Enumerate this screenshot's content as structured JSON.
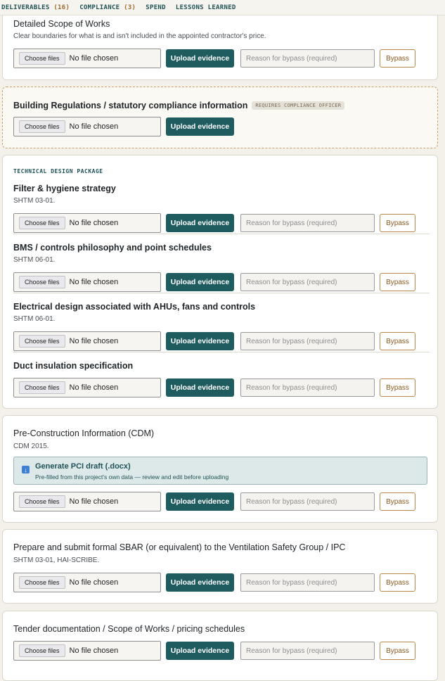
{
  "nav": {
    "deliverables_label": "DELIVERABLES",
    "deliverables_count": "(16)",
    "compliance_label": "COMPLIANCE",
    "compliance_count": "(3)",
    "spend_label": "SPEND",
    "lessons_label": "LESSONS LEARNED"
  },
  "common": {
    "choose_files": "Choose files",
    "no_file": "No file chosen",
    "upload": "Upload evidence",
    "reason_placeholder": "Reason for bypass (required)",
    "bypass": "Bypass"
  },
  "card1": {
    "title": "Detailed Scope of Works",
    "description": "Clear boundaries for what is and isn't included in the appointed contractor's price."
  },
  "card2": {
    "title": "Building Regulations / statutory compliance information",
    "badge": "REQUIRES COMPLIANCE OFFICER"
  },
  "card3": {
    "section": "TECHNICAL DESIGN PACKAGE",
    "items": [
      {
        "title": "Filter & hygiene strategy",
        "ref": "SHTM 03-01."
      },
      {
        "title": "BMS / controls philosophy and point schedules",
        "ref": "SHTM 06-01."
      },
      {
        "title": "Electrical design associated with AHUs, fans and controls",
        "ref": "SHTM 06-01."
      },
      {
        "title": "Duct insulation specification",
        "ref": ""
      }
    ]
  },
  "card4": {
    "title": "Pre-Construction Information (CDM)",
    "ref": "CDM 2015.",
    "generate_title": "Generate PCI draft (.docx)",
    "generate_sub": "Pre-filled from this project's own data — review and edit before uploading"
  },
  "card5": {
    "title": "Prepare and submit formal SBAR (or equivalent) to the Ventilation Safety Group / IPC",
    "ref": "SHTM 03-01, HAI-SCRIBE."
  },
  "card6": {
    "title": "Tender documentation / Scope of Works / pricing schedules"
  }
}
